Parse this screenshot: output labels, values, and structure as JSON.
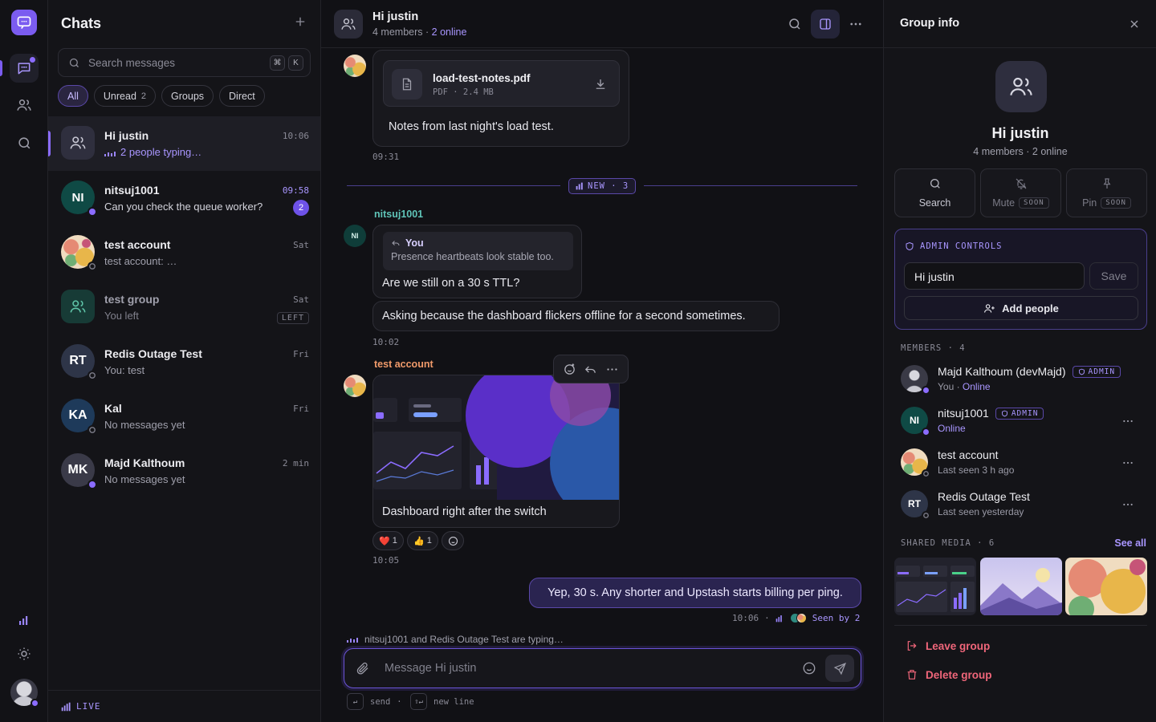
{
  "rail": {
    "icons": [
      "app-logo-icon",
      "chats-icon",
      "contacts-icon",
      "search-icon",
      "stats-icon",
      "theme-icon"
    ]
  },
  "sidebar": {
    "title": "Chats",
    "search_placeholder": "Search messages",
    "shortcut": [
      "⌘",
      "K"
    ],
    "filters": [
      {
        "label": "All",
        "count": "",
        "active": true
      },
      {
        "label": "Unread",
        "count": "2"
      },
      {
        "label": "Groups",
        "count": ""
      },
      {
        "label": "Direct",
        "count": ""
      }
    ],
    "chats": [
      {
        "name": "Hi justin",
        "preview": "2 people typing…",
        "time": "10:06",
        "initials": "",
        "typing": true
      },
      {
        "name": "nitsuj1001",
        "preview": "Can you check the queue worker?",
        "time": "09:58",
        "initials": "NI",
        "badge": "2"
      },
      {
        "name": "test account",
        "preview": "test account: …",
        "time": "Sat"
      },
      {
        "name": "test group",
        "preview": "You left",
        "time": "Sat",
        "tag": "LEFT"
      },
      {
        "name": "Redis Outage Test",
        "preview": "You: test",
        "time": "Fri",
        "initials": "RT"
      },
      {
        "name": "Kal",
        "preview": "No messages yet",
        "time": "Fri",
        "initials": "KA"
      },
      {
        "name": "Majd Kalthoum",
        "preview": "No messages yet",
        "time": "2 min",
        "initials": "MK"
      }
    ],
    "footer": "LIVE"
  },
  "main": {
    "title": "Hi justin",
    "members": "4 members",
    "online": "2 online",
    "file": {
      "name": "load-test-notes.pdf",
      "meta": "PDF · 2.4 MB"
    },
    "file_caption": "Notes from last night's load test.",
    "file_time": "09:31",
    "new_label": "NEW · 3",
    "nitsuj": {
      "avatar": "NI",
      "sender": "nitsuj1001",
      "reply_who": "You",
      "reply_text": "Presence heartbeats look stable too.",
      "text1": "Are we still on a 30 s TTL?",
      "text2": "Asking because the dashboard flickers offline for a second sometimes.",
      "time": "10:02"
    },
    "test": {
      "sender": "test account",
      "caption": "Dashboard right after the switch",
      "reactions": [
        {
          "emoji": "❤️",
          "count": "1"
        },
        {
          "emoji": "👍",
          "count": "1"
        }
      ],
      "time": "10:05"
    },
    "own": {
      "text": "Yep, 30 s. Any shorter and Upstash starts billing per ping.",
      "time": "10:06",
      "seen": "Seen by 2"
    },
    "typing": "nitsuj1001 and Redis Outage Test are typing…",
    "composer_placeholder": "Message Hi justin",
    "hints": [
      {
        "key": "↵",
        "label": "send"
      },
      {
        "key": "⇧↵",
        "label": "new line"
      }
    ]
  },
  "panel": {
    "title": "Group info",
    "name": "Hi justin",
    "sub": "4 members · 2 online",
    "actions": [
      {
        "label": "Search",
        "soon": ""
      },
      {
        "label": "Mute",
        "soon": "SOON"
      },
      {
        "label": "Pin",
        "soon": "SOON"
      }
    ],
    "admin_title": "ADMIN CONTROLS",
    "admin_value": "Hi justin",
    "save": "Save",
    "add_people": "Add people",
    "members_title": "MEMBERS · 4",
    "members": [
      {
        "name": "Majd Kalthoum (devMajd)",
        "admin": "ADMIN",
        "status_you": "You · ",
        "status": "Online"
      },
      {
        "name": "nitsuj1001",
        "admin": "ADMIN",
        "initials": "NI",
        "status": "Online"
      },
      {
        "name": "test account",
        "status": "Last seen 3 h ago"
      },
      {
        "name": "Redis Outage Test",
        "initials": "RT",
        "status": "Last seen yesterday"
      }
    ],
    "shared_title": "SHARED MEDIA · 6",
    "see_all": "See all",
    "leave": "Leave group",
    "delete": "Delete group"
  },
  "colors": {
    "accent": "#7b5cf0",
    "accent_text": "#a996ff",
    "danger": "#f0667a",
    "bg": "#111115"
  }
}
